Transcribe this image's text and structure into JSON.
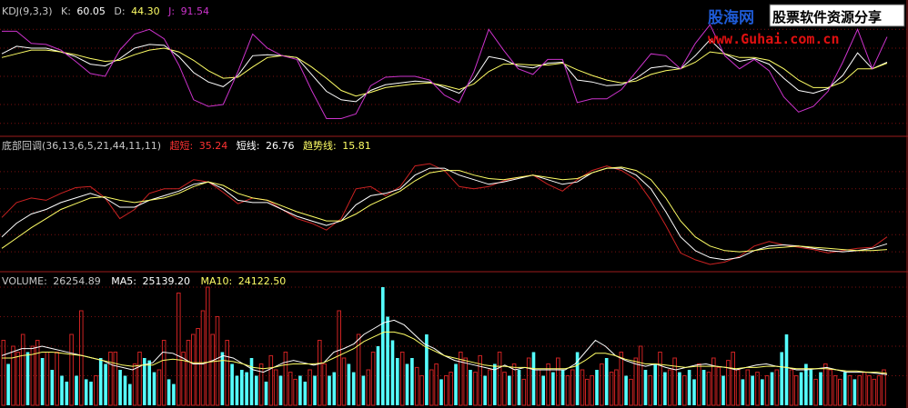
{
  "theme": {
    "background": "#000000",
    "border": "#9b1b1b",
    "grid": "#7a1010",
    "text_gray": "#c8c8c8",
    "white": "#ffffff",
    "yellow": "#ffff66",
    "magenta": "#cc33cc",
    "red": "#cc2222",
    "cyan": "#55ffff"
  },
  "watermark": {
    "brand": "股海网",
    "slogan": "股票软件资源分享",
    "url": "www.Guhai.com.cn"
  },
  "chart_data": [
    {
      "type": "line",
      "panel": "kdj",
      "header": {
        "name": "KDJ(9,3,3)",
        "k_label": "K:",
        "k_value": "60.05",
        "d_label": "D:",
        "d_value": "44.30",
        "j_label": "J:",
        "j_value": "91.54"
      },
      "ylim": [
        -10,
        110
      ],
      "gridlines": [
        0,
        20,
        50,
        80,
        100
      ],
      "x": [
        0,
        4,
        8,
        12,
        16,
        20,
        24,
        28,
        32,
        36,
        40,
        44,
        48,
        52,
        56,
        60,
        64,
        68,
        72,
        76,
        80,
        84,
        88,
        92,
        96,
        100,
        104,
        108,
        112,
        116,
        120,
        124,
        128,
        132,
        136,
        140,
        144,
        148,
        152,
        156,
        160,
        164,
        168,
        172,
        176,
        180,
        184,
        188,
        192,
        196,
        200,
        204,
        208,
        212,
        216,
        220,
        224,
        228,
        232,
        236,
        240
      ],
      "series": [
        {
          "key": "K",
          "color": "white",
          "values": [
            74,
            82,
            80,
            80,
            76,
            71,
            63,
            61,
            69,
            80,
            84,
            83,
            71,
            54,
            44,
            39,
            51,
            72,
            73,
            72,
            70,
            52,
            34,
            25,
            23,
            35,
            41,
            43,
            45,
            44,
            38,
            32,
            47,
            71,
            68,
            61,
            59,
            64,
            65,
            46,
            44,
            40,
            41,
            48,
            59,
            61,
            58,
            72,
            89,
            74,
            66,
            69,
            63,
            48,
            35,
            32,
            37,
            51,
            75,
            58,
            65
          ]
        },
        {
          "key": "D",
          "color": "yellow",
          "values": [
            70,
            74,
            78,
            78,
            76,
            73,
            69,
            66,
            67,
            73,
            78,
            80,
            76,
            67,
            56,
            48,
            49,
            60,
            70,
            72,
            70,
            60,
            48,
            35,
            29,
            33,
            38,
            40,
            42,
            43,
            40,
            36,
            42,
            55,
            63,
            63,
            62,
            62,
            64,
            57,
            51,
            46,
            43,
            45,
            52,
            56,
            58,
            65,
            76,
            74,
            70,
            70,
            67,
            58,
            46,
            38,
            38,
            44,
            58,
            58,
            64
          ]
        },
        {
          "key": "J",
          "color": "magenta",
          "values": [
            98,
            98,
            85,
            84,
            78,
            66,
            53,
            50,
            78,
            95,
            100,
            90,
            62,
            25,
            18,
            20,
            55,
            95,
            80,
            72,
            68,
            35,
            5,
            5,
            10,
            40,
            49,
            50,
            50,
            46,
            30,
            22,
            55,
            100,
            78,
            58,
            52,
            68,
            68,
            22,
            26,
            26,
            36,
            55,
            74,
            72,
            58,
            85,
            105,
            72,
            58,
            68,
            56,
            28,
            12,
            18,
            34,
            65,
            100,
            58,
            92
          ]
        }
      ]
    },
    {
      "type": "line",
      "panel": "bottom_pullback",
      "header": {
        "name": "底部回调(36,13,6,5,21,44,11,11)",
        "s1_label": "超短:",
        "s1_value": "35.24",
        "s2_label": "短线:",
        "s2_value": "26.76",
        "s3_label": "趋势线:",
        "s3_value": "15.81"
      },
      "ylim": [
        0,
        100
      ],
      "gridlines": [
        15,
        30,
        50,
        70,
        85
      ],
      "x": [
        0,
        4,
        8,
        12,
        16,
        20,
        24,
        28,
        32,
        36,
        40,
        44,
        48,
        52,
        56,
        60,
        64,
        68,
        72,
        76,
        80,
        84,
        88,
        92,
        96,
        100,
        104,
        108,
        112,
        116,
        120,
        124,
        128,
        132,
        136,
        140,
        144,
        148,
        152,
        156,
        160,
        164,
        168,
        172,
        176,
        180,
        184,
        188,
        192,
        196,
        200,
        204,
        208,
        212,
        216,
        220,
        224,
        228,
        232,
        236,
        240
      ],
      "series": [
        {
          "key": "超短",
          "color": "red",
          "values": [
            45,
            58,
            62,
            60,
            66,
            71,
            72,
            62,
            44,
            52,
            66,
            70,
            70,
            78,
            76,
            67,
            57,
            62,
            60,
            52,
            44,
            40,
            34,
            44,
            70,
            72,
            64,
            72,
            90,
            92,
            86,
            72,
            70,
            72,
            77,
            80,
            82,
            74,
            68,
            78,
            86,
            90,
            86,
            78,
            60,
            38,
            14,
            8,
            4,
            6,
            11,
            20,
            24,
            21,
            19,
            17,
            14,
            16,
            18,
            19,
            28
          ]
        },
        {
          "key": "短线",
          "color": "white",
          "values": [
            28,
            40,
            48,
            52,
            58,
            62,
            66,
            62,
            54,
            54,
            60,
            64,
            68,
            74,
            76,
            70,
            60,
            58,
            58,
            52,
            46,
            42,
            38,
            42,
            56,
            64,
            66,
            70,
            82,
            88,
            88,
            82,
            78,
            74,
            76,
            79,
            82,
            78,
            74,
            76,
            84,
            88,
            88,
            82,
            70,
            50,
            28,
            16,
            10,
            8,
            10,
            16,
            20,
            21,
            20,
            18,
            16,
            15,
            16,
            18,
            22
          ]
        },
        {
          "key": "趋势线",
          "color": "yellow",
          "values": [
            18,
            27,
            36,
            44,
            52,
            57,
            62,
            63,
            60,
            58,
            60,
            62,
            66,
            72,
            76,
            73,
            66,
            62,
            60,
            55,
            50,
            46,
            42,
            42,
            48,
            56,
            62,
            68,
            77,
            84,
            86,
            86,
            82,
            79,
            78,
            80,
            82,
            80,
            78,
            79,
            84,
            88,
            89,
            86,
            78,
            62,
            42,
            28,
            20,
            16,
            15,
            16,
            18,
            19,
            20,
            19,
            18,
            17,
            16,
            16,
            17
          ]
        }
      ]
    },
    {
      "type": "bar",
      "panel": "volume",
      "header": {
        "name": "VOLUME:",
        "value": "26254.89",
        "ma5_label": "MA5:",
        "ma5_value": "25139.20",
        "ma10_label": "MA10:",
        "ma10_value": "24122.50"
      },
      "ylim": [
        0,
        100
      ],
      "gridlines": [
        25,
        50,
        75,
        100
      ],
      "bar_up_color": "red",
      "bar_down_color": "cyan",
      "values": [
        55,
        35,
        50,
        45,
        60,
        45,
        50,
        55,
        40,
        45,
        30,
        45,
        25,
        20,
        60,
        25,
        80,
        22,
        20,
        25,
        40,
        35,
        45,
        45,
        30,
        25,
        18,
        35,
        45,
        40,
        38,
        28,
        30,
        55,
        22,
        18,
        95,
        45,
        55,
        60,
        65,
        80,
        100,
        60,
        75,
        45,
        55,
        35,
        25,
        30,
        28,
        40,
        25,
        35,
        20,
        42,
        30,
        25,
        45,
        28,
        22,
        25,
        20,
        30,
        25,
        55,
        35,
        25,
        28,
        80,
        40,
        35,
        28,
        60,
        25,
        30,
        45,
        50,
        100,
        75,
        55,
        40,
        45,
        35,
        40,
        32,
        25,
        60,
        30,
        35,
        22,
        25,
        28,
        35,
        45,
        40,
        30,
        28,
        42,
        25,
        30,
        35,
        45,
        28,
        25,
        35,
        30,
        22,
        40,
        45,
        30,
        25,
        35,
        28,
        40,
        30,
        25,
        30,
        45,
        30,
        22,
        25,
        30,
        35,
        40,
        28,
        30,
        45,
        25,
        22,
        40,
        50,
        30,
        25,
        35,
        45,
        28,
        30,
        40,
        28,
        25,
        30,
        22,
        35,
        30,
        28,
        40,
        32,
        25,
        38,
        45,
        30,
        22,
        30,
        25,
        28,
        22,
        25,
        28,
        30,
        45,
        60,
        30,
        25,
        28,
        35,
        30,
        22,
        28,
        35,
        30,
        25,
        22,
        28,
        25,
        22,
        25,
        28,
        25,
        22,
        25,
        30
      ],
      "up": [
        1,
        0,
        1,
        1,
        1,
        0,
        1,
        1,
        0,
        1,
        0,
        1,
        0,
        0,
        1,
        0,
        1,
        0,
        0,
        1,
        0,
        0,
        1,
        1,
        0,
        0,
        0,
        1,
        1,
        0,
        0,
        0,
        1,
        1,
        0,
        0,
        1,
        1,
        1,
        1,
        1,
        1,
        1,
        1,
        1,
        0,
        1,
        0,
        0,
        0,
        0,
        0,
        0,
        1,
        0,
        1,
        1,
        0,
        1,
        1,
        1,
        0,
        0,
        1,
        0,
        1,
        1,
        0,
        0,
        1,
        1,
        0,
        0,
        1,
        0,
        1,
        1,
        0,
        0,
        0,
        0,
        0,
        1,
        0,
        0,
        1,
        1,
        0,
        1,
        1,
        0,
        1,
        1,
        0,
        1,
        1,
        0,
        1,
        1,
        0,
        1,
        0,
        1,
        1,
        0,
        1,
        0,
        1,
        1,
        0,
        1,
        0,
        1,
        0,
        1,
        0,
        1,
        1,
        0,
        1,
        1,
        1,
        0,
        1,
        0,
        1,
        1,
        1,
        0,
        1,
        1,
        1,
        0,
        1,
        0,
        1,
        0,
        1,
        1,
        0,
        1,
        0,
        0,
        1,
        0,
        1,
        1,
        1,
        0,
        1,
        1,
        1,
        0,
        1,
        0,
        1,
        0,
        1,
        0,
        1,
        0,
        0,
        1,
        1,
        0,
        0,
        0,
        1,
        0,
        1,
        1,
        1,
        1,
        0,
        1,
        0,
        1,
        1,
        1,
        1,
        1,
        1,
        0,
        1,
        0,
        1,
        1,
        1,
        0,
        1
      ],
      "ma5": [
        42,
        45,
        48,
        48,
        50,
        48,
        46,
        44,
        42,
        40,
        38,
        34,
        32,
        30,
        34,
        36,
        45,
        44,
        40,
        35,
        35,
        38,
        42,
        40,
        35,
        30,
        28,
        32,
        36,
        38,
        36,
        34,
        36,
        45,
        48,
        52,
        60,
        65,
        70,
        72,
        68,
        60,
        52,
        48,
        42,
        38,
        36,
        34,
        32,
        30,
        34,
        30,
        32,
        30,
        30,
        30,
        30,
        35,
        45,
        55,
        50,
        42,
        38,
        35,
        33,
        35,
        32,
        30,
        32,
        34,
        35,
        33,
        32,
        30,
        32,
        34,
        35,
        33,
        32,
        30,
        30,
        31,
        32,
        30,
        28,
        28,
        28,
        27,
        26
      ],
      "ma10": [
        40,
        40,
        42,
        43,
        45,
        45,
        44,
        43,
        42,
        40,
        38,
        36,
        34,
        33,
        34,
        34,
        38,
        39,
        38,
        36,
        36,
        37,
        38,
        37,
        35,
        32,
        31,
        32,
        34,
        35,
        35,
        35,
        36,
        40,
        44,
        48,
        54,
        58,
        62,
        62,
        60,
        56,
        50,
        46,
        42,
        40,
        38,
        36,
        34,
        33,
        33,
        32,
        32,
        31,
        31,
        31,
        31,
        33,
        38,
        44,
        44,
        42,
        39,
        37,
        35,
        35,
        34,
        33,
        32,
        33,
        33,
        33,
        32,
        31,
        32,
        32,
        33,
        33,
        32,
        31,
        31,
        31,
        31,
        30,
        29,
        29,
        28,
        28,
        27
      ]
    }
  ]
}
